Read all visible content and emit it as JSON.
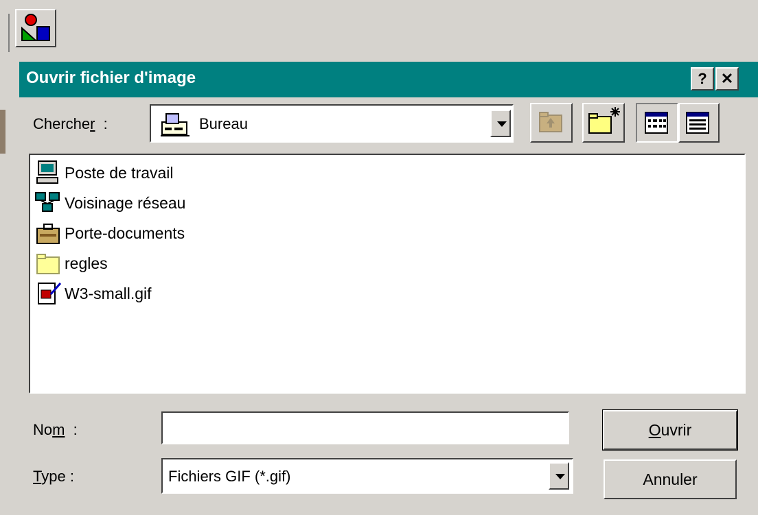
{
  "dialog": {
    "title": "Ouvrir fichier d'image",
    "help_label": "?",
    "close_label": "✕"
  },
  "look_in": {
    "label_prefix": "Cherche",
    "label_accel": "r",
    "label_suffix": " :",
    "value": "Bureau"
  },
  "files": [
    {
      "name": "Poste de travail",
      "icon": "computer-icon"
    },
    {
      "name": "Voisinage réseau",
      "icon": "network-icon"
    },
    {
      "name": "Porte-documents",
      "icon": "briefcase-icon"
    },
    {
      "name": "regles",
      "icon": "folder-icon"
    },
    {
      "name": "W3-small.gif",
      "icon": "gif-image-icon"
    }
  ],
  "name_field": {
    "label_prefix": "No",
    "label_accel": "m",
    "label_suffix": " :",
    "value": ""
  },
  "type_field": {
    "label_accel": "T",
    "label_suffix": "ype :",
    "value": "Fichiers GIF (*.gif)"
  },
  "buttons": {
    "open_accel": "O",
    "open_rest": "uvrir",
    "cancel": "Annuler"
  },
  "colors": {
    "title_bar": "#008080",
    "face": "#d6d3ce"
  }
}
